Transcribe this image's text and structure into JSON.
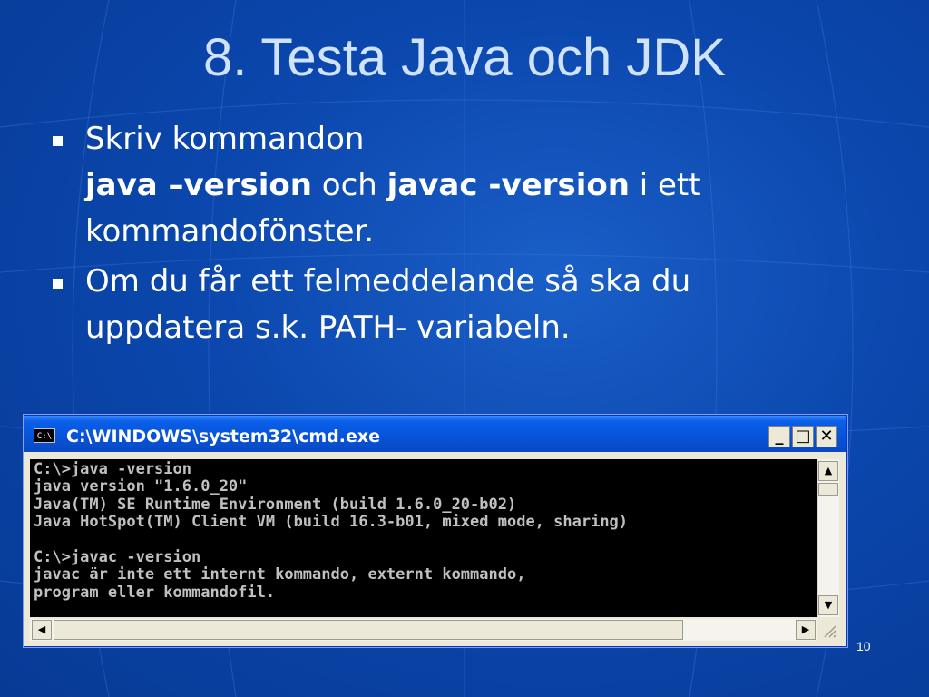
{
  "slide": {
    "title": "8. Testa Java och JDK",
    "bullets": [
      {
        "line1": "Skriv kommandon",
        "bold1": "java –version",
        "mid": " och ",
        "bold2": "javac -version",
        "tail": " i ett",
        "line3": "kommandofönster."
      },
      {
        "line1": "Om du får ett felmeddelande så ska du",
        "line2": "uppdatera s.k. PATH- variabeln."
      }
    ],
    "page_number": "10"
  },
  "cmd_window": {
    "icon_text": "C:\\",
    "title": "C:\\WINDOWS\\system32\\cmd.exe",
    "minimize_label": "_",
    "maximize_label": "□",
    "close_label": "✕",
    "console_output": "C:\\>java -version\njava version \"1.6.0_20\"\nJava(TM) SE Runtime Environment (build 1.6.0_20-b02)\nJava HotSpot(TM) Client VM (build 16.3-b01, mixed mode, sharing)\n\nC:\\>javac -version\njavac är inte ett internt kommando, externt kommando,\nprogram eller kommandofil.",
    "scroll_up": "▲",
    "scroll_down": "▼",
    "scroll_left": "◀",
    "scroll_right": "▶"
  }
}
